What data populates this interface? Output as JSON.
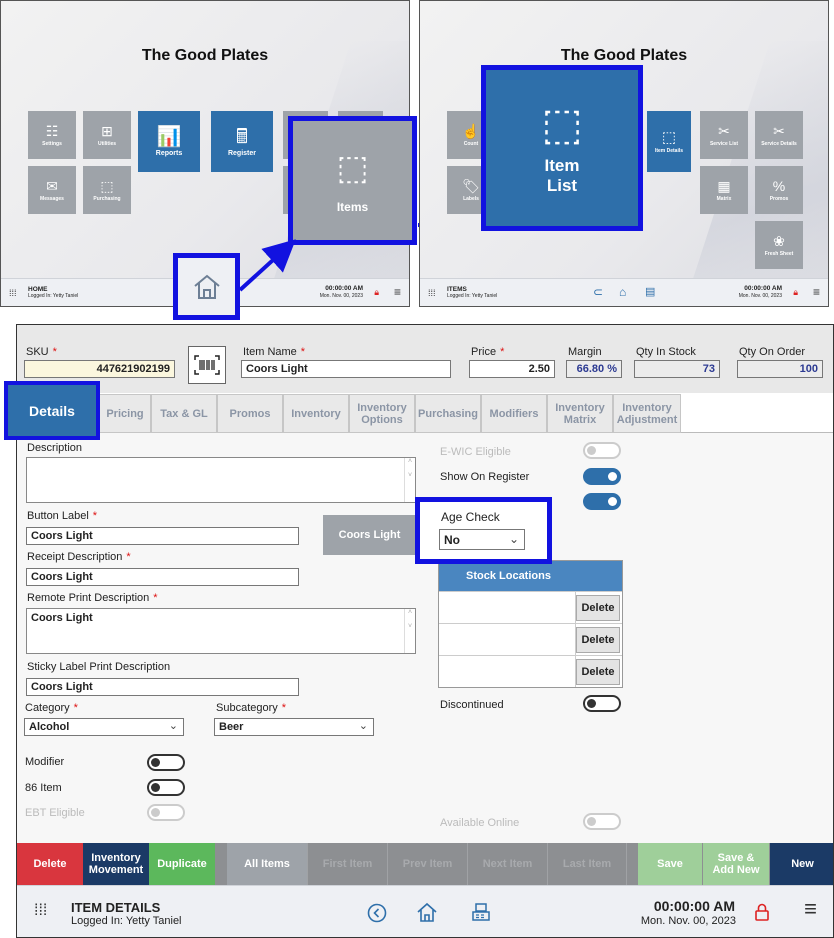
{
  "home_panel": {
    "title": "The Good Plates",
    "tiles": {
      "settings": "Settings",
      "utilities": "Utilities",
      "reports": "Reports",
      "register": "Register",
      "messages": "Messages",
      "purchasing": "Purchasing"
    },
    "zoom_tile": "Items",
    "footer": {
      "title": "HOME",
      "logged_in": "Logged In:  Yetty Taniel",
      "time": "00:00:00 AM",
      "date": "Mon. Nov. 00, 2023"
    }
  },
  "items_panel": {
    "title": "The Good Plates",
    "tiles": {
      "count": "Count",
      "labels": "Labels",
      "item_details": "Item Details",
      "service_list": "Service List",
      "service_details": "Service Details",
      "matrix": "Matrix",
      "promos": "Promos",
      "fresh_sheet": "Fresh Sheet"
    },
    "zoom_tile": "Item List",
    "footer": {
      "title": "ITEMS",
      "logged_in": "Logged In:  Yetty Taniel",
      "time": "00:00:00 AM",
      "date": "Mon. Nov. 00, 2023"
    }
  },
  "item_form": {
    "header": {
      "sku_label": "SKU",
      "sku_value": "447621902199",
      "name_label": "Item Name",
      "name_value": "Coors Light",
      "price_label": "Price",
      "price_value": "2.50",
      "margin_label": "Margin",
      "margin_value": "66.80 %",
      "qty_stock_label": "Qty In Stock",
      "qty_stock_value": "73",
      "qty_order_label": "Qty On Order",
      "qty_order_value": "100",
      "required_mark": "*"
    },
    "tabs": [
      "Details",
      "Pricing",
      "Tax & GL",
      "Promos",
      "Inventory",
      "Inventory Options",
      "Purchasing",
      "Modifiers",
      "Inventory Matrix",
      "Inventory Adjustment"
    ],
    "details": {
      "description_label": "Description",
      "description_value": "",
      "button_label_label": "Button Label",
      "button_label_value": "Coors Light",
      "button_preview": "Coors Light",
      "receipt_label": "Receipt Description",
      "receipt_value": "Coors Light",
      "remote_label": "Remote Print Description",
      "remote_value": "Coors Light",
      "sticky_label": "Sticky Label Print Description",
      "sticky_value": "Coors Light",
      "category_label": "Category",
      "category_value": "Alcohol",
      "subcategory_label": "Subcategory",
      "subcategory_value": "Beer",
      "modifier_label": "Modifier",
      "item86_label": "86 Item",
      "ebt_label": "EBT Eligible",
      "ewic_label": "E-WIC Eligible",
      "show_register_label": "Show On Register",
      "age_check_label": "Age Check",
      "age_check_value": "No",
      "stock_locations_label": "Stock Locations",
      "delete_label": "Delete",
      "discontinued_label": "Discontinued",
      "available_online_label": "Available Online"
    },
    "buttons": {
      "delete": "Delete",
      "inventory_movement": "Inventory Movement",
      "duplicate": "Duplicate",
      "all_items": "All Items",
      "first_item": "First Item",
      "prev_item": "Prev Item",
      "next_item": "Next Item",
      "last_item": "Last Item",
      "save": "Save",
      "save_add_new": "Save & Add New",
      "new": "New"
    },
    "footer": {
      "title": "ITEM DETAILS",
      "logged_in": "Logged In:  Yetty Taniel",
      "time": "00:00:00 AM",
      "date": "Mon. Nov. 00, 2023"
    }
  },
  "colors": {
    "accent": "#2e6faa",
    "highlight": "#1212e0",
    "delete": "#d9363e",
    "duplicate": "#5cb85c",
    "navy": "#1b3a66"
  }
}
